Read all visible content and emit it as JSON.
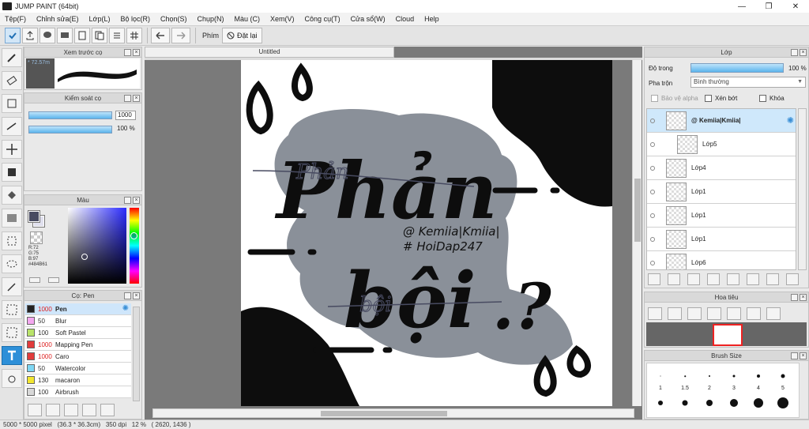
{
  "window": {
    "title": "JUMP PAINT (64bit)",
    "minimize": "—",
    "maximize": "❐",
    "close": "✕"
  },
  "menu": [
    "Tệp(F)",
    "Chỉnh sửa(E)",
    "Lớp(L)",
    "Bộ lọc(R)",
    "Chọn(S)",
    "Chụp(N)",
    "Màu (C)",
    "Xem(V)",
    "Công cụ(T)",
    "Cửa sổ(W)",
    "Cloud",
    "Help"
  ],
  "toolbar": {
    "phim_label": "Phím",
    "reset_label": "Đặt lại"
  },
  "brush_preview": {
    "title": "Xem trước cọ",
    "value": "* 72.57m"
  },
  "brush_control": {
    "title": "Kiểm soát cọ",
    "size_value": "1000",
    "opacity_value": "100 %"
  },
  "color": {
    "title": "Màu",
    "foreground": "#484B61",
    "r": "R:72",
    "g": "G:75",
    "b": "B:97",
    "hex": "#484B61"
  },
  "brush_list": {
    "title": "Cọ: Pen",
    "items": [
      {
        "size": "1000",
        "name": "Pen",
        "swatch": "#222222",
        "red_size": true,
        "selected": true
      },
      {
        "size": "50",
        "name": "Blur",
        "swatch": "#f4a7f0",
        "red_size": false,
        "selected": false
      },
      {
        "size": "100",
        "name": "Soft Pastel",
        "swatch": "#b9e36a",
        "red_size": false,
        "selected": false
      },
      {
        "size": "1000",
        "name": "Mapping Pen",
        "swatch": "#e23b3b",
        "red_size": true,
        "selected": false
      },
      {
        "size": "1000",
        "name": "Caro",
        "swatch": "#e23b3b",
        "red_size": true,
        "selected": false
      },
      {
        "size": "50",
        "name": "Watercolor",
        "swatch": "#7ed7f3",
        "red_size": false,
        "selected": false
      },
      {
        "size": "130",
        "name": "macaron",
        "swatch": "#f2e62f",
        "red_size": false,
        "selected": false
      },
      {
        "size": "100",
        "name": "Airbrush",
        "swatch": "#d8d8d8",
        "red_size": false,
        "selected": false
      }
    ]
  },
  "document": {
    "tab": "Untitled"
  },
  "artwork": {
    "title_text": "Phản bội",
    "handle_line1": "@ Kemiia|Kmiia|",
    "handle_line2": "# HoiDap247",
    "title_top": "Phản",
    "title_bottom": "bội",
    "title_mark": ".?",
    "script_top": "Phản",
    "script_bottom": "bội"
  },
  "layers": {
    "title": "Lớp",
    "opacity_label": "Độ trong",
    "opacity_value": "100 %",
    "opacity_level": 1.0,
    "blend_label": "Pha trộn",
    "blend_value": "Bình thường",
    "protect_alpha": "Bảo vệ alpha",
    "clip_label": "Xén bớt",
    "lock_label": "Khóa",
    "items": [
      {
        "name": "@ Kemiia|Kmiia|",
        "bold": true,
        "selected": true
      },
      {
        "name": "Lớp5",
        "bold": false,
        "selected": false
      },
      {
        "name": "Lớp4",
        "bold": false,
        "selected": false
      },
      {
        "name": "Lớp1",
        "bold": false,
        "selected": false
      },
      {
        "name": "Lớp1",
        "bold": false,
        "selected": false
      },
      {
        "name": "Lớp1",
        "bold": false,
        "selected": false
      },
      {
        "name": "Lớp6",
        "bold": false,
        "selected": false
      }
    ]
  },
  "navigator": {
    "title": "Hoa tiêu"
  },
  "brush_size": {
    "title": "Brush Size",
    "labels": [
      "1",
      "1.5",
      "2",
      "3",
      "4",
      "5",
      "7",
      "10",
      "12",
      "15",
      "20",
      "25"
    ]
  },
  "status": {
    "text": "5000 * 5000 pixel   (36.3 * 36.3cm)   350 dpi   12 %   ( 2620, 1436 )"
  }
}
